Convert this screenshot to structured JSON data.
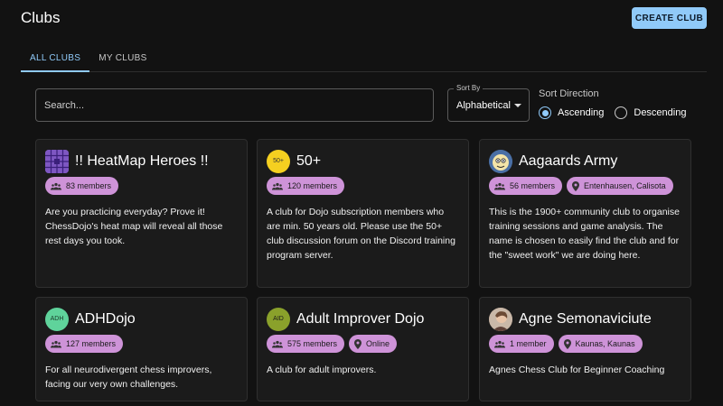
{
  "header": {
    "title": "Clubs",
    "create_label": "CREATE CLUB"
  },
  "tabs": [
    {
      "label": "ALL CLUBS",
      "active": true
    },
    {
      "label": "MY CLUBS",
      "active": false
    }
  ],
  "search": {
    "placeholder": "Search...",
    "value": ""
  },
  "sort": {
    "label": "Sort By",
    "selected": "Alphabetical"
  },
  "direction": {
    "title": "Sort Direction",
    "options": [
      {
        "label": "Ascending",
        "checked": true
      },
      {
        "label": "Descending",
        "checked": false
      }
    ]
  },
  "colors": {
    "accent": "#90caf9",
    "chip": "#ce93d8",
    "background": "#121212",
    "card": "#1b1b1b"
  },
  "clubs": [
    {
      "name": "!! HeatMap Heroes !!",
      "avatar": {
        "type": "heatmap-icon",
        "bg": "#7e57c2"
      },
      "members": "83 members",
      "location": "",
      "description": "Are you practicing everyday? Prove it! ChessDojo's heat map will reveal all those rest days you took."
    },
    {
      "name": "50+",
      "avatar": {
        "type": "text",
        "text": "50+",
        "bg": "#f5d020",
        "fg": "#333333"
      },
      "members": "120 members",
      "location": "",
      "description": "A club for Dojo subscription members who are min. 50 years old. Please use the 50+ club discussion forum on the Discord training program server."
    },
    {
      "name": "Aagaards Army",
      "avatar": {
        "type": "cartoon-icon",
        "bg": "#4a6fa5"
      },
      "members": "56 members",
      "location": "Entenhausen, Calisota",
      "description": "This is the 1900+ community club to organise training sessions and game analysis. The name is chosen to easily find the club and for the \"sweet work\" we are doing here."
    },
    {
      "name": "ADHDojo",
      "avatar": {
        "type": "text",
        "text": "ADH",
        "bg": "#5fd39b",
        "fg": "#1a3a2a"
      },
      "members": "127 members",
      "location": "",
      "description": "For all neurodivergent chess improvers, facing our very own challenges."
    },
    {
      "name": "Adult Improver Dojo",
      "avatar": {
        "type": "text",
        "text": "AID",
        "bg": "#8aa12b",
        "fg": "#1a1a1a"
      },
      "members": "575 members",
      "location": "Online",
      "description": "A club for adult improvers."
    },
    {
      "name": "Agne Semonaviciute",
      "avatar": {
        "type": "photo-icon",
        "bg": "#8d6e63"
      },
      "members": "1 member",
      "location": "Kaunas, Kaunas",
      "description": "Agnes Chess Club for Beginner Coaching"
    }
  ]
}
